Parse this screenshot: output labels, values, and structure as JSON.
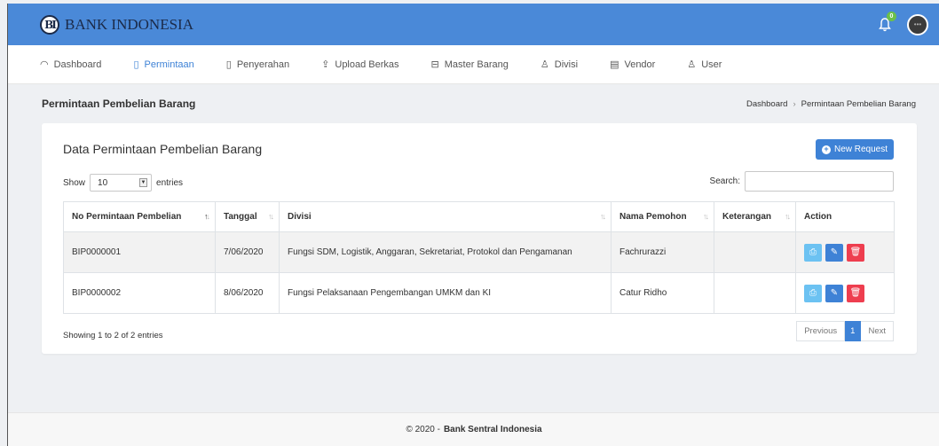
{
  "brand": {
    "logo_mark": "B",
    "name": "BANK INDONESIA"
  },
  "topbar": {
    "notification_count": "0",
    "notification_icon": "bell-icon",
    "avatar_icon": "avatar"
  },
  "nav": [
    {
      "label": "Dashboard",
      "icon": "dashboard-icon",
      "active": false
    },
    {
      "label": "Permintaan",
      "icon": "clipboard-icon",
      "active": true
    },
    {
      "label": "Penyerahan",
      "icon": "clipboard-icon",
      "active": false
    },
    {
      "label": "Upload Berkas",
      "icon": "upload-icon",
      "active": false
    },
    {
      "label": "Master Barang",
      "icon": "box-icon",
      "active": false
    },
    {
      "label": "Divisi",
      "icon": "users-icon",
      "active": false
    },
    {
      "label": "Vendor",
      "icon": "store-icon",
      "active": false
    },
    {
      "label": "User",
      "icon": "user-icon",
      "active": false
    }
  ],
  "page": {
    "title": "Permintaan Pembelian Barang",
    "breadcrumb": [
      "Dashboard",
      "Permintaan Pembelian Barang"
    ]
  },
  "card": {
    "title": "Data Permintaan Pembelian Barang",
    "new_button": "New Request",
    "show_label": "Show",
    "entries_value": "10",
    "entries_label": "entries",
    "search_label": "Search:",
    "search_value": ""
  },
  "table": {
    "columns": [
      "No Permintaan Pembelian",
      "Tanggal",
      "Divisi",
      "Nama Pemohon",
      "Keterangan",
      "Action"
    ],
    "rows": [
      [
        "BIP0000001",
        "7/06/2020",
        "Fungsi SDM, Logistik, Anggaran, Sekretariat, Protokol dan Pengamanan",
        "Fachrurazzi",
        ""
      ],
      [
        "BIP0000002",
        "8/06/2020",
        "Fungsi Pelaksanaan Pengembangan UMKM dan KI",
        "Catur Ridho",
        ""
      ]
    ]
  },
  "footer_info": "Showing 1 to 2 of 2 entries",
  "pagination": {
    "previous": "Previous",
    "current": "1",
    "next": "Next"
  },
  "footer": {
    "prefix": "© 2020 -",
    "org": "Bank Sentral Indonesia"
  },
  "colors": {
    "topbar": "#4a89d8",
    "accent": "#3e82d6",
    "print": "#6cc2f2",
    "delete": "#ee3e4f"
  }
}
